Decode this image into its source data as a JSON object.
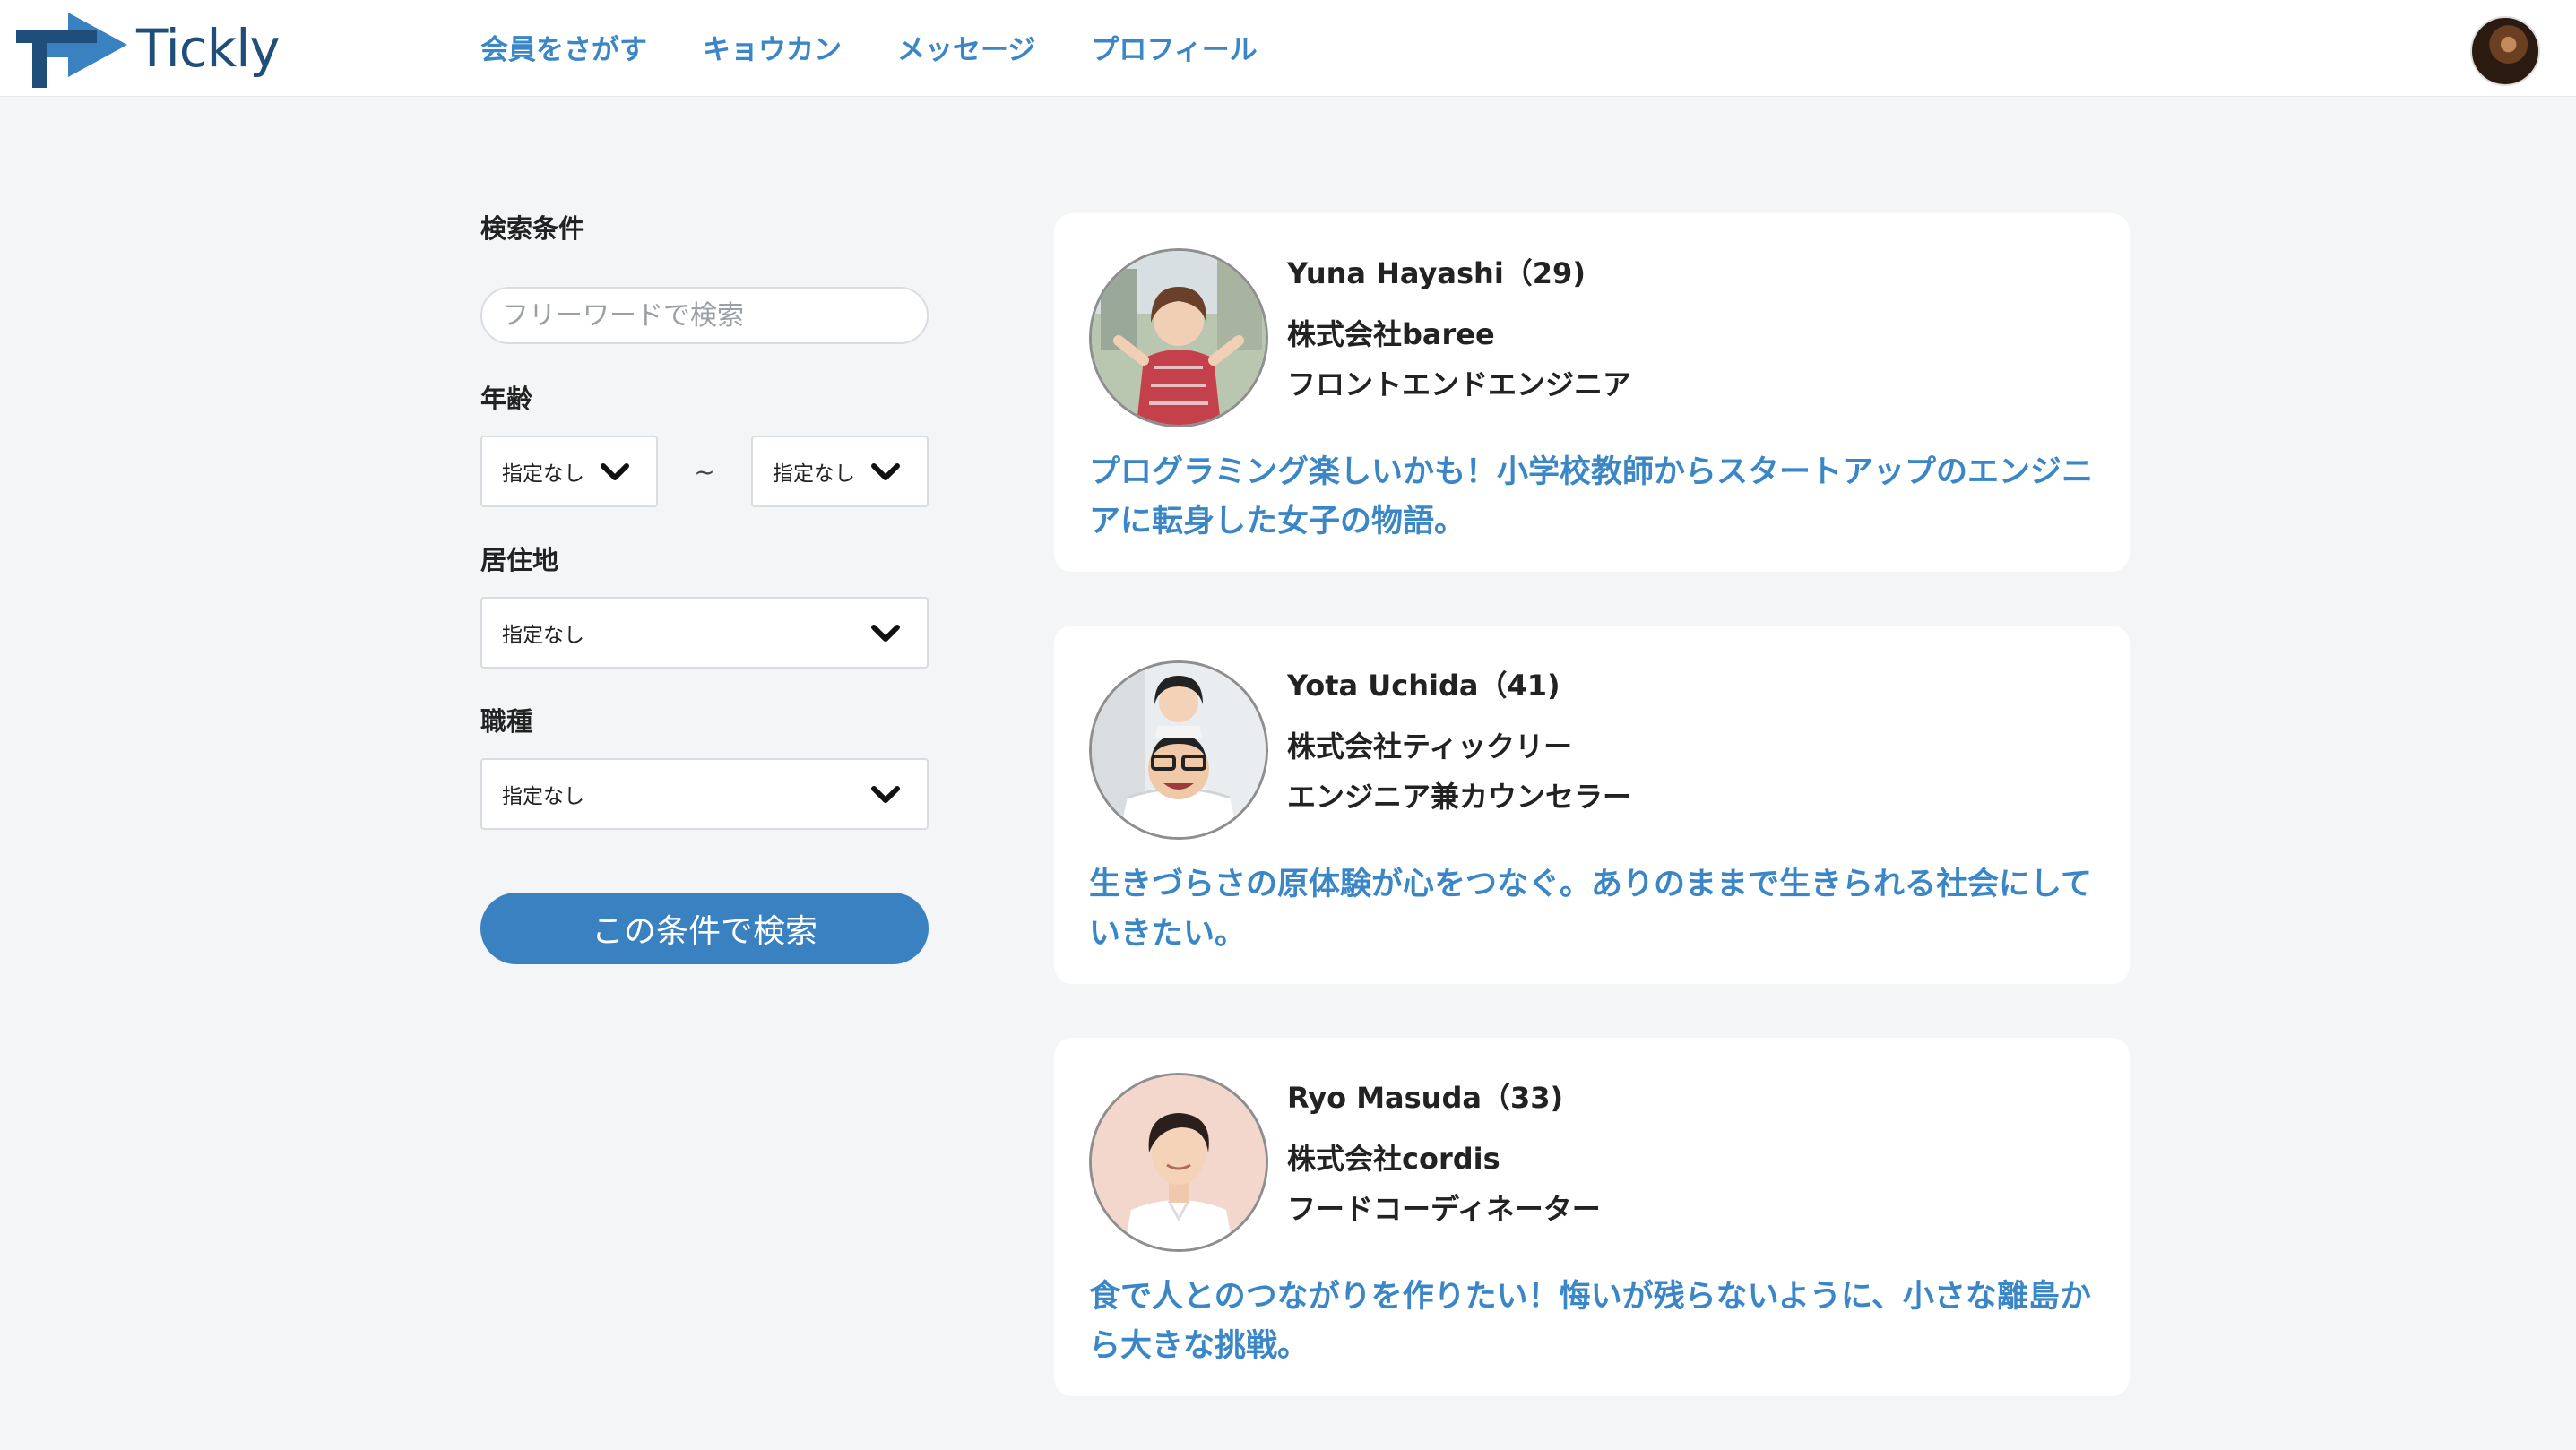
{
  "header": {
    "logo_text": "Tickly",
    "nav": [
      {
        "label": "会員をさがす"
      },
      {
        "label": "キョウカン"
      },
      {
        "label": "メッセージ"
      },
      {
        "label": "プロフィール"
      }
    ]
  },
  "sidebar": {
    "title": "検索条件",
    "free_word_placeholder": "フリーワードで検索",
    "age_label": "年齢",
    "age_min": "指定なし",
    "age_separator": "~",
    "age_max": "指定なし",
    "residence_label": "居住地",
    "residence_value": "指定なし",
    "job_label": "職種",
    "job_value": "指定なし",
    "search_button": "この条件で検索"
  },
  "members": [
    {
      "name": "Yuna Hayashi（29)",
      "company": "株式会社baree",
      "job": "フロントエンドエンジニア",
      "catchcopy": "プログラミング楽しいかも！小学校教師からスタートアップのエンジニアに転身した女子の物語。"
    },
    {
      "name": "Yota Uchida（41)",
      "company": "株式会社ティックリー",
      "job": "エンジニア兼カウンセラー",
      "catchcopy": "生きづらさの原体験が心をつなぐ。ありのままで生きられる社会にしていきたい。"
    },
    {
      "name": "Ryo Masuda（33)",
      "company": "株式会社cordis",
      "job": "フードコーディネーター",
      "catchcopy": "食で人とのつながりを作りたい！悔いが残らないように、小さな離島から大きな挑戦。"
    }
  ],
  "colors": {
    "accent": "#3a86c6",
    "button": "#3a81c1",
    "logo": "#1e4e79",
    "background": "#f4f5f7"
  }
}
